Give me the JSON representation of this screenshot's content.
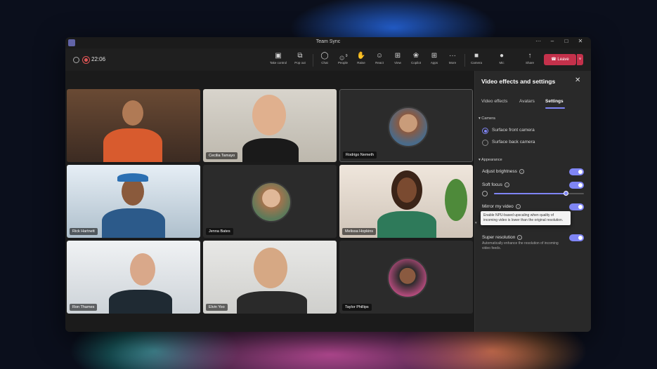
{
  "window": {
    "title": "Team Sync"
  },
  "titlebar": {
    "more": "···",
    "minimize": "–",
    "maximize": "□",
    "close": "✕"
  },
  "toolbar": {
    "timer": "22:06",
    "tools": [
      {
        "label": "Take control",
        "icon": "take-control-icon",
        "glyph": "▣"
      },
      {
        "label": "Pop out",
        "icon": "pop-out-icon",
        "glyph": "⧉"
      },
      {
        "label": "Chat",
        "icon": "chat-icon",
        "glyph": "◯"
      },
      {
        "label": "People",
        "icon": "people-icon",
        "glyph": "☺"
      },
      {
        "label": "Raise",
        "icon": "raise-hand-icon",
        "glyph": "✋"
      },
      {
        "label": "React",
        "icon": "react-icon",
        "glyph": "☺"
      },
      {
        "label": "View",
        "icon": "view-icon",
        "glyph": "⊞"
      },
      {
        "label": "Copilot",
        "icon": "copilot-icon",
        "glyph": "❀"
      },
      {
        "label": "Apps",
        "icon": "apps-icon",
        "glyph": "⊞"
      },
      {
        "label": "More",
        "icon": "more-icon",
        "glyph": "···"
      },
      {
        "label": "Camera",
        "icon": "camera-icon",
        "glyph": "■"
      },
      {
        "label": "Mic",
        "icon": "mic-icon",
        "glyph": "●"
      },
      {
        "label": "Share",
        "icon": "share-icon",
        "glyph": "↑"
      }
    ],
    "people_count": "9",
    "leave_label": "Leave",
    "leave_chevron": "˅"
  },
  "participants": [
    {
      "name": "",
      "video": true
    },
    {
      "name": "Cecilia Tamayo",
      "video": true
    },
    {
      "name": "Rodrigo Nemeth",
      "video": false
    },
    {
      "name": "Rick Hartnett",
      "video": true
    },
    {
      "name": "Jenna Bates",
      "video": false
    },
    {
      "name": "Melissa Hopkins",
      "video": true
    },
    {
      "name": "Ron Thames",
      "video": true
    },
    {
      "name": "Elvin Yoo",
      "video": true
    },
    {
      "name": "Taylor Phillips",
      "video": false
    }
  ],
  "panel": {
    "title": "Video effects and settings",
    "close": "✕",
    "tabs": [
      "Video effects",
      "Avatars",
      "Settings"
    ],
    "active_tab": "Settings",
    "camera_section": "Camera",
    "camera_options": [
      "Surface front camera",
      "Surface back camera"
    ],
    "selected_camera": "Surface front camera",
    "appearance_section": "Appearance",
    "adjust_brightness": "Adjust brightness",
    "soft_focus": "Soft focus",
    "soft_focus_level": 0.8,
    "mirror_my_video": "Mirror my video",
    "tooltip": "Enable NPU-based upscaling when quality of incoming video is lower than the original resolution.",
    "super_resolution": "Super resolution",
    "super_resolution_desc": "Automatically enhance the resolution of incoming video feeds.",
    "toggles": {
      "adjust_brightness": true,
      "soft_focus": true,
      "mirror_my_video": true,
      "super_resolution": true
    },
    "accent": "#7f85f5"
  }
}
